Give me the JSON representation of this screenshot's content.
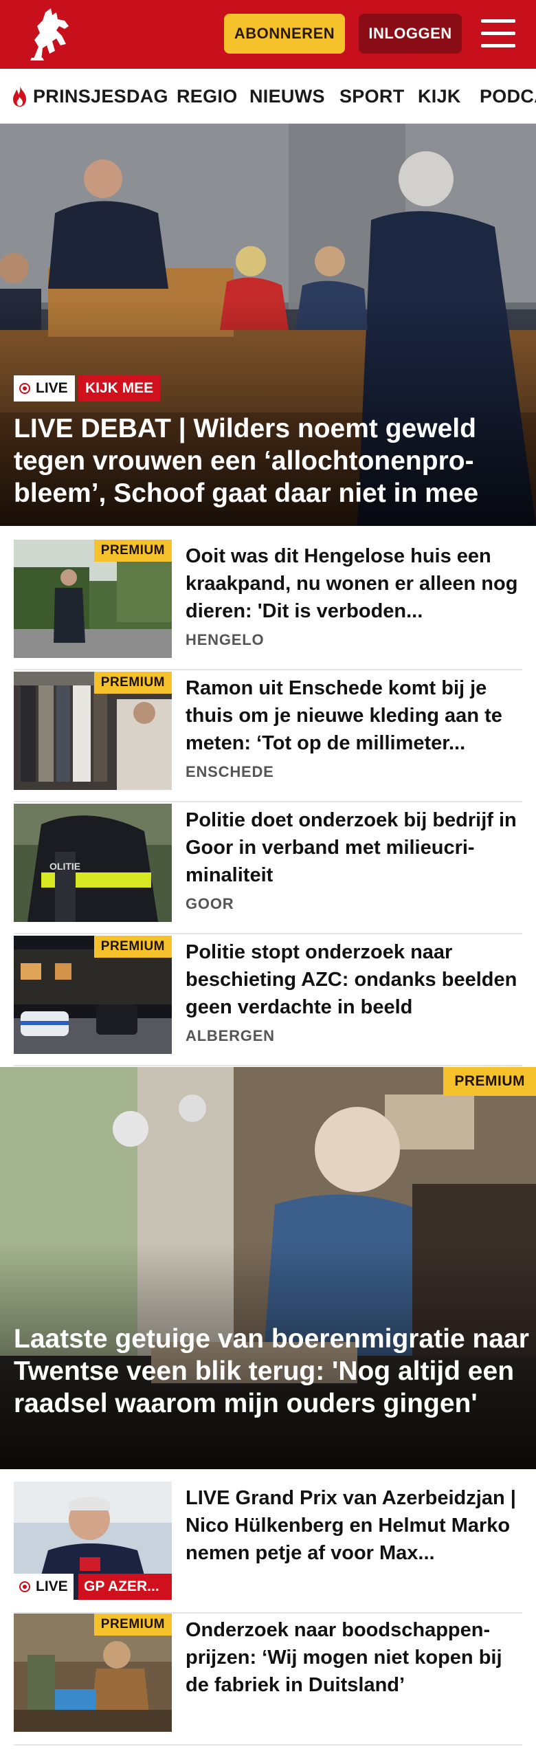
{
  "header": {
    "subscribe_label": "ABONNEREN",
    "login_label": "INLOGGEN",
    "brand_color": "#c8101c"
  },
  "nav": {
    "items": [
      "PRINSJESDAG",
      "REGIO",
      "NIEUWS",
      "SPORT",
      "KIJK",
      "PODCA"
    ]
  },
  "hero": {
    "live_label": "LIVE",
    "watch_label": "KIJK MEE",
    "title": "LIVE DEBAT | Wilders noemt geweld tegen vrouwen een ‘allochtonenpro-bleem’, Schoof gaat daar niet in mee"
  },
  "articles": [
    {
      "premium_label": "PREMIUM",
      "title": "Ooit was dit Hengelose huis een kraakpand, nu wonen er alleen nog dieren: 'Dit is verboden...",
      "region": "HENGELO"
    },
    {
      "premium_label": "PREMIUM",
      "title": "Ramon uit Enschede komt bij je thuis om je nieuwe kleding aan te meten: ‘Tot op de millimeter...",
      "region": "ENSCHEDE"
    },
    {
      "title": "Politie doet onderzoek bij bedrijf in Goor in verband met milieucri-minaliteit",
      "region": "GOOR"
    },
    {
      "premium_label": "PREMIUM",
      "title": "Politie stopt onderzoek naar beschieting AZC: ondanks beelden geen verdachte in beeld",
      "region": "ALBERGEN"
    }
  ],
  "big_story": {
    "premium_label": "PREMIUM",
    "title": "Laatste getuige van boerenmigratie naar Twentse veen blik terug: 'Nog altijd een raadsel waarom mijn ouders gingen'"
  },
  "more_articles": [
    {
      "live_label": "LIVE",
      "watch_label": "GP AZER...",
      "title": "LIVE Grand Prix van Azerbeidzjan | Nico Hülkenberg en Helmut Marko nemen petje af voor Max..."
    },
    {
      "premium_label": "PREMIUM",
      "title": "Onderzoek naar boodschappen-prijzen: ‘Wij mogen niet kopen bij de fabriek in Duitsland’"
    }
  ]
}
